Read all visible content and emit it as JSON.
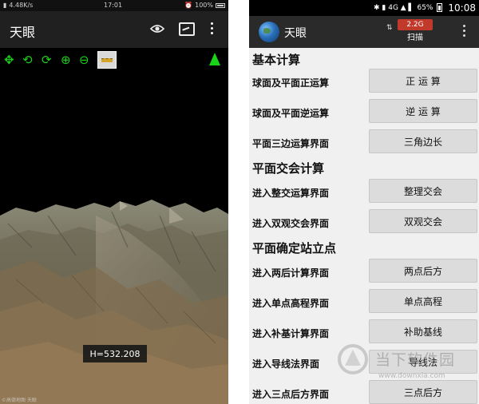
{
  "left": {
    "status": {
      "speed": "4.48K/s",
      "time": "17:01",
      "battery": "100%"
    },
    "title": "天眼",
    "toolbar": {
      "pan": "✥",
      "rotate_h": "⟲",
      "rotate_v": "⟳",
      "zoom_in": "⊕",
      "zoom_out": "⊖"
    },
    "height_readout": "H=532.208",
    "copyright": "©高德地图 天眼"
  },
  "right": {
    "status": {
      "icons": "✱ ▮ 4G ▲ ▌",
      "battery": "65%",
      "time": "10:08"
    },
    "title": "天眼",
    "net_icon": "⇅",
    "speed_badge": "2.2G",
    "scan_label": "扫描",
    "sections": [
      {
        "header": "基本计算",
        "rows": [
          {
            "label": "球面及平面正运算",
            "button": "正 运 算"
          },
          {
            "label": "球面及平面逆运算",
            "button": "逆 运 算"
          },
          {
            "label": "平面三边运算界面",
            "button": "三角边长"
          }
        ]
      },
      {
        "header": "平面交会计算",
        "rows": [
          {
            "label": "进入整交运算界面",
            "button": "整理交会"
          },
          {
            "label": "进入双观交会界面",
            "button": "双观交会"
          }
        ]
      },
      {
        "header": "平面确定站立点",
        "rows": [
          {
            "label": "进入两后计算界面",
            "button": "两点后方"
          },
          {
            "label": "进入单点高程界面",
            "button": "单点高程"
          },
          {
            "label": "进入补基计算界面",
            "button": "补助基线"
          },
          {
            "label": "进入导线法界面",
            "button": "导线法"
          },
          {
            "label": "进入三点后方界面",
            "button": "三点后方"
          }
        ]
      }
    ],
    "watermark": {
      "text": "当下软件园",
      "url": "www.downxia.com"
    }
  }
}
